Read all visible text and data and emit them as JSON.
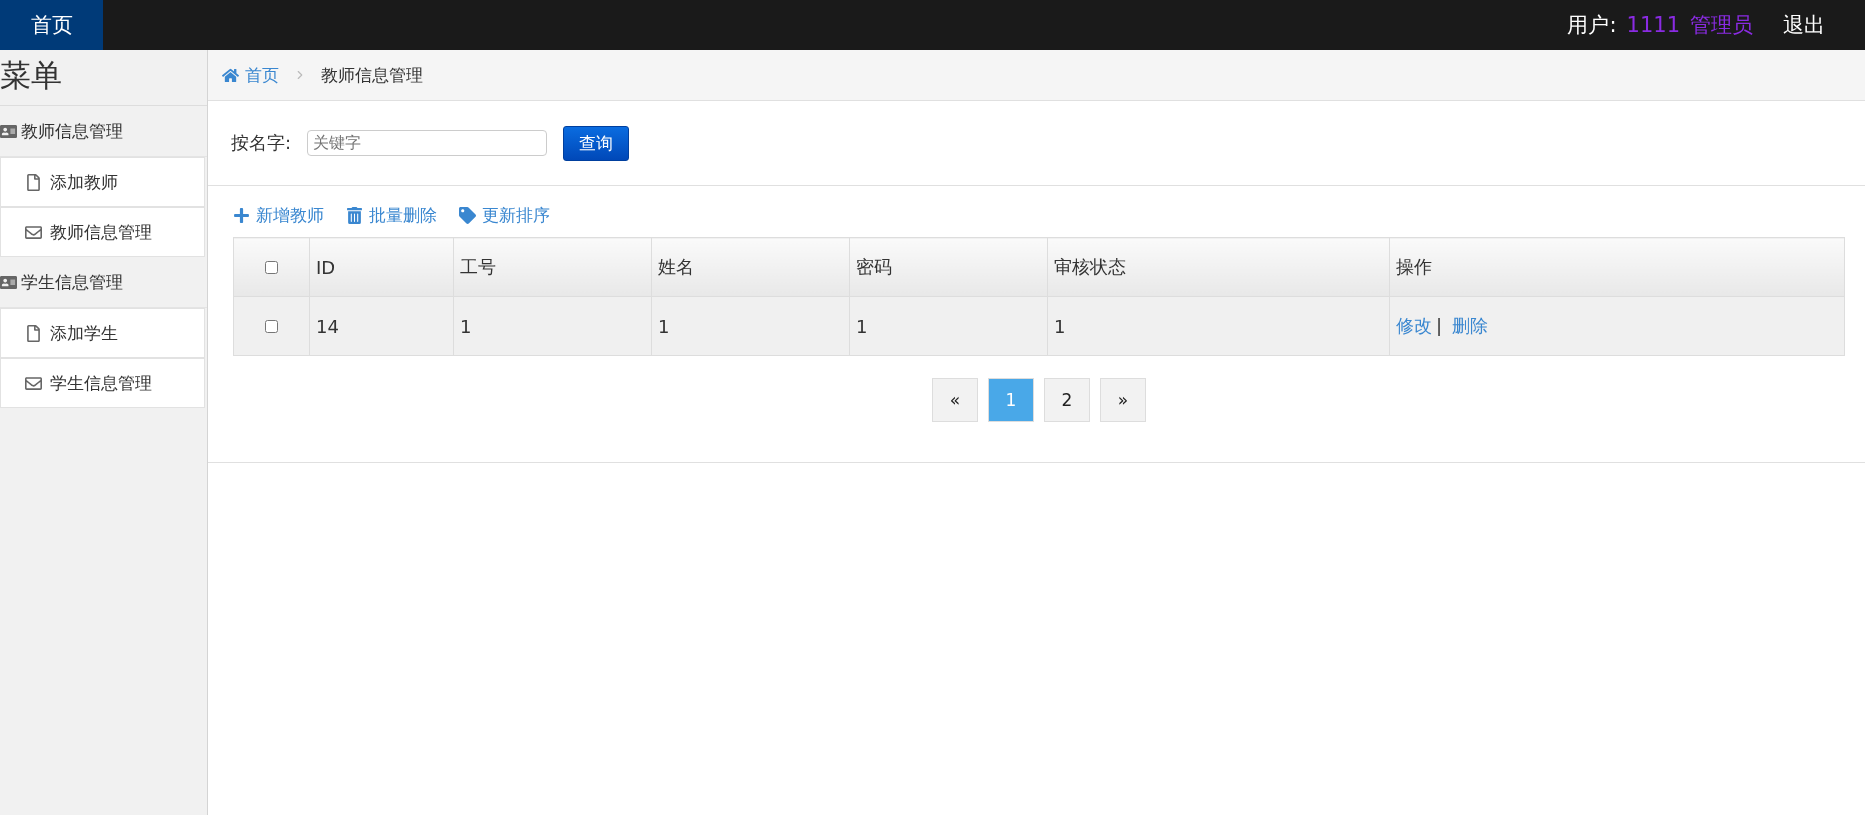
{
  "topbar": {
    "home": "首页",
    "user_label": "用户:",
    "user_id": "1111",
    "role": "管理员",
    "logout": "退出"
  },
  "sidebar": {
    "title": "菜单",
    "groups": [
      {
        "label": "教师信息管理",
        "items": [
          {
            "label": "添加教师",
            "kind": "page"
          },
          {
            "label": "教师信息管理",
            "kind": "list"
          }
        ]
      },
      {
        "label": "学生信息管理",
        "items": [
          {
            "label": "添加学生",
            "kind": "page"
          },
          {
            "label": "学生信息管理",
            "kind": "list"
          }
        ]
      }
    ]
  },
  "breadcrumb": {
    "home": "首页",
    "current": "教师信息管理"
  },
  "search": {
    "label": "按名字:",
    "placeholder": "关键字",
    "button": "查询"
  },
  "actions": [
    {
      "label": "新增教师",
      "kind": "add"
    },
    {
      "label": "批量删除",
      "kind": "delete"
    },
    {
      "label": "更新排序",
      "kind": "tag"
    }
  ],
  "table": {
    "header_checked": false,
    "columns": [
      "ID",
      "工号",
      "姓名",
      "密码",
      "审核状态",
      "操作"
    ],
    "rows": [
      {
        "checked": false,
        "cells": [
          "14",
          "1",
          "1",
          "1",
          "1"
        ],
        "links": [
          "修改",
          "删除"
        ],
        "separator": "|"
      }
    ]
  },
  "pagination": [
    {
      "label": "«",
      "selected": false
    },
    {
      "label": "1",
      "selected": true
    },
    {
      "label": "2",
      "selected": false
    },
    {
      "label": "»",
      "selected": false
    }
  ]
}
